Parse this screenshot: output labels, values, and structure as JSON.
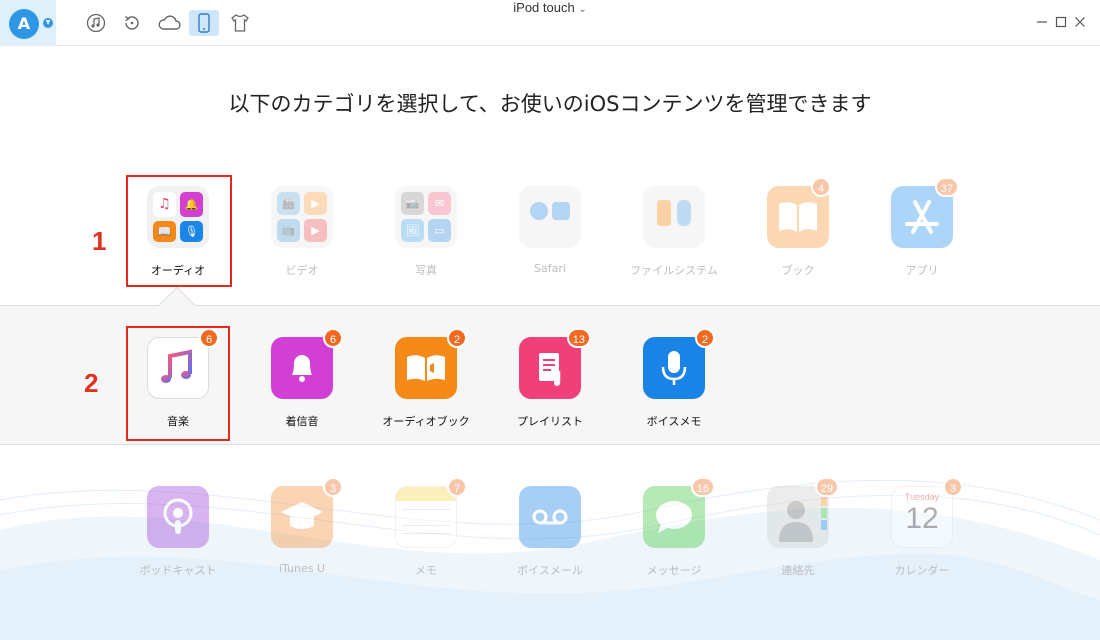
{
  "window": {
    "device_name": "iPod touch"
  },
  "toolbar": {
    "logo_letter": "A",
    "icons": [
      "music-note-icon",
      "restore-icon",
      "cloud-icon",
      "device-icon",
      "shirt-icon"
    ]
  },
  "heading": "以下のカテゴリを選択して、お使いのiOSコンテンツを管理できます",
  "categories": [
    {
      "label": "オーディオ",
      "badge": null
    },
    {
      "label": "ビデオ",
      "badge": null
    },
    {
      "label": "写真",
      "badge": null
    },
    {
      "label": "Safari",
      "badge": null
    },
    {
      "label": "ファイルシステム",
      "badge": null
    },
    {
      "label": "ブック",
      "badge": "4"
    },
    {
      "label": "アプリ",
      "badge": "37"
    }
  ],
  "audio_items": [
    {
      "label": "音楽",
      "badge": "6"
    },
    {
      "label": "着信音",
      "badge": "6"
    },
    {
      "label": "オーディオブック",
      "badge": "2"
    },
    {
      "label": "プレイリスト",
      "badge": "13"
    },
    {
      "label": "ボイスメモ",
      "badge": "2"
    }
  ],
  "other_items": [
    {
      "label": "ポッドキャスト",
      "badge": null
    },
    {
      "label": "iTunes U",
      "badge": "3"
    },
    {
      "label": "メモ",
      "badge": "7"
    },
    {
      "label": "ボイスメール",
      "badge": null
    },
    {
      "label": "メッセージ",
      "badge": "16"
    },
    {
      "label": "連絡先",
      "badge": "29"
    },
    {
      "label": "カレンダー",
      "badge": "3"
    }
  ],
  "calendar_tile": {
    "weekday": "Tuesday",
    "day": "12"
  },
  "steps": {
    "one": "1",
    "two": "2"
  },
  "colors": {
    "accent": "#2f97e6",
    "badge": "#f26a21",
    "highlight": "#e22a1b"
  }
}
